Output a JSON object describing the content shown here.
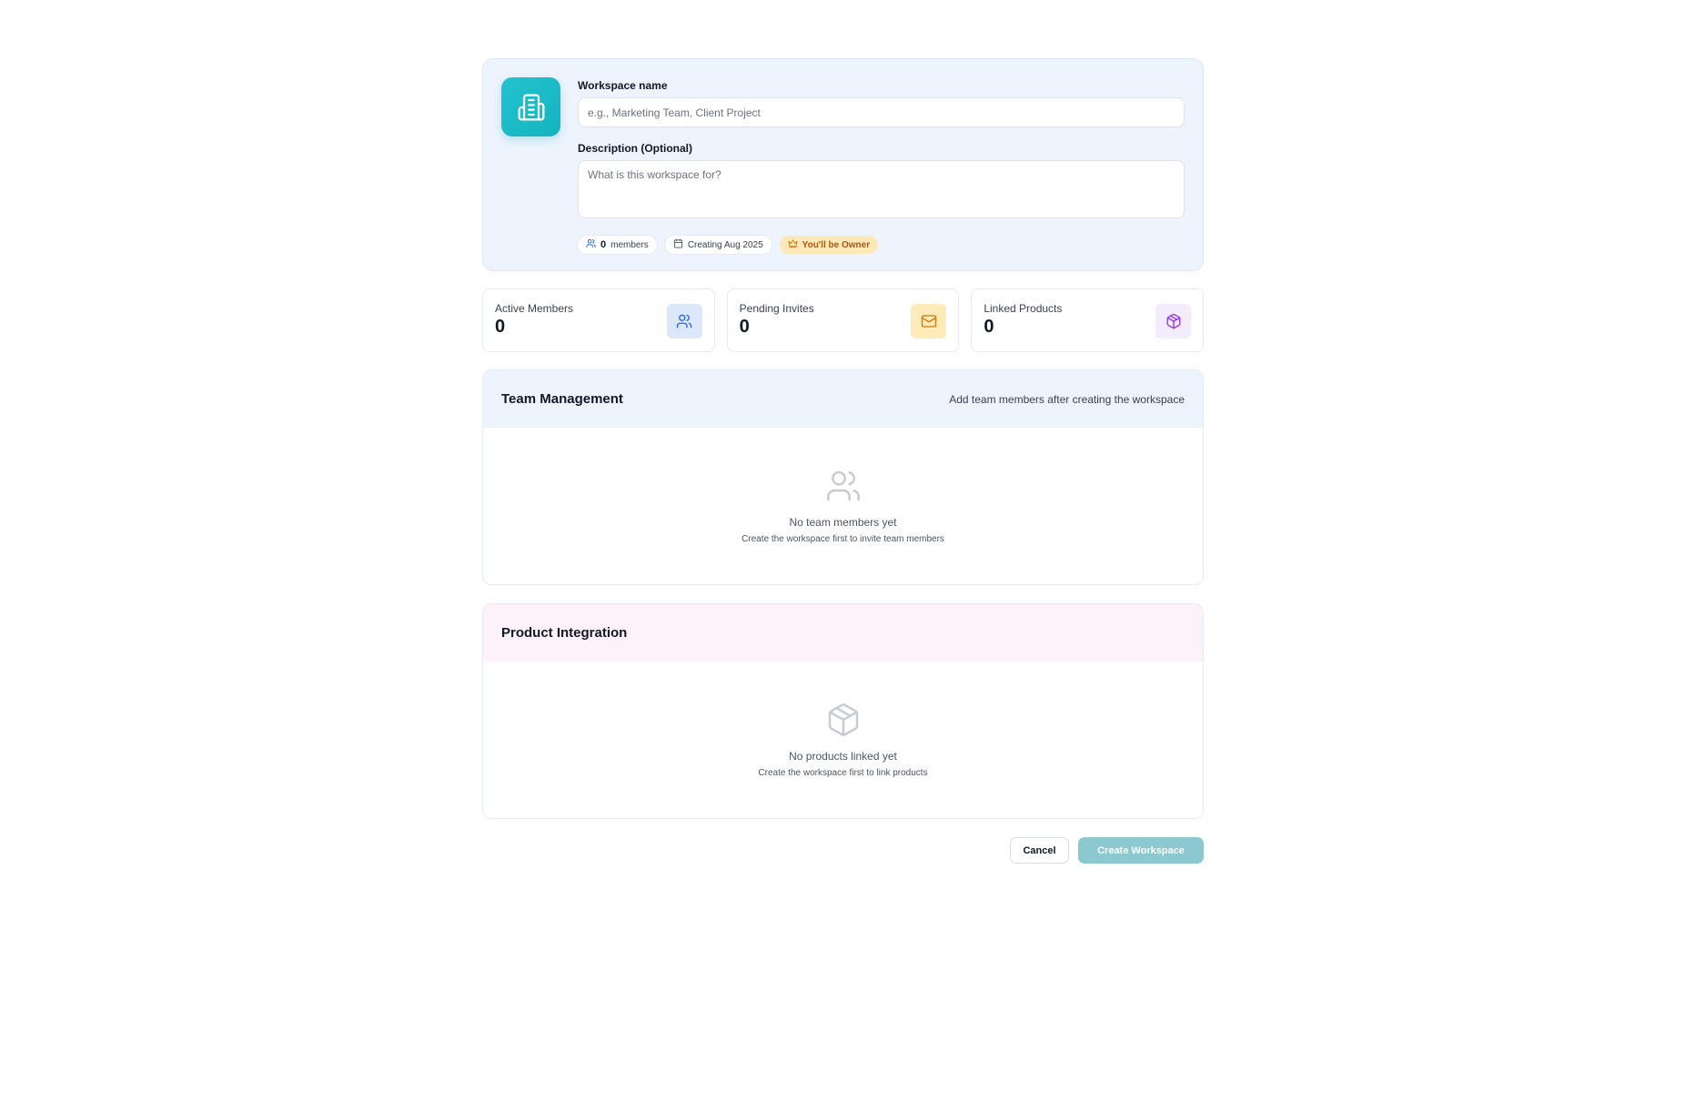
{
  "workspace_form": {
    "name_label": "Workspace name",
    "name_placeholder": "e.g., Marketing Team, Client Project",
    "name_value": "",
    "description_label": "Description (Optional)",
    "description_placeholder": "What is this workspace for?",
    "description_value": "",
    "logo_icon": "building-icon"
  },
  "chips": {
    "members_count": "0",
    "members_label": "members",
    "created_label": "Creating Aug 2025",
    "owner_label": "You'll be Owner"
  },
  "stats": [
    {
      "label": "Active Members",
      "value": "0",
      "icon": "users-icon",
      "color": "#2563eb",
      "bg": "#dbe8fb"
    },
    {
      "label": "Pending Invites",
      "value": "0",
      "icon": "mail-icon",
      "color": "#d97706",
      "bg": "#fdebb9"
    },
    {
      "label": "Linked Products",
      "value": "0",
      "icon": "package-icon",
      "color": "#9333ea",
      "bg": "#f3ecfd"
    }
  ],
  "team": {
    "title": "Team Management",
    "hint": "Add team members after creating the workspace",
    "empty_title": "No team members yet",
    "empty_sub": "Create the workspace first to invite team members"
  },
  "product": {
    "title": "Product Integration",
    "empty_title": "No products linked yet",
    "empty_sub": "Create the workspace first to link products"
  },
  "actions": {
    "cancel_label": "Cancel",
    "create_label": "Create Workspace"
  },
  "colors": {
    "accent": "#14b3c0",
    "create_disabled": "#8cc8cf"
  }
}
